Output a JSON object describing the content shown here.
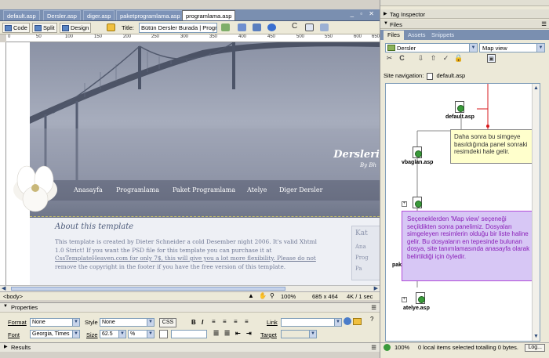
{
  "doc_tabs": [
    "default.asp",
    "Dersler.asp",
    "diger.asp",
    "paketprogramlama.asp",
    "programlama.asp"
  ],
  "active_tab_index": 4,
  "toolbar": {
    "code_label": "Code",
    "split_label": "Split",
    "design_label": "Design",
    "title_label": "Title:",
    "title_value": "Bütün Dersler Burada | Progra"
  },
  "page": {
    "brand": "Dersleri",
    "brand_sub": "By Bh",
    "nav_items": [
      "Anasayfa",
      "Programlama",
      "Paket Programlama",
      "Atelye",
      "Diger Dersler"
    ],
    "about_title": "About this template",
    "about_lines": [
      "This template is created by Dieter Schneider a cold Desember night 2006. It's valid Xhtml",
      "1.0 Strict! If you want the PSD file for this template you can purchase it at",
      "CssTemplateHeaven.com for only 7$, this will give you a lot more flexibility. Please do not",
      "remove the copyright in the footer if you have the free version of this template."
    ],
    "about_link": "CssTemplateHeaven.com",
    "side_card": [
      "Kat",
      "Ana",
      "Prog",
      "Pa"
    ]
  },
  "ruler_marks": [
    "0",
    "50",
    "100",
    "150",
    "200",
    "250",
    "300",
    "350",
    "400",
    "450",
    "500",
    "550",
    "600",
    "650"
  ],
  "status": {
    "tag": "<body>",
    "zoom": "100%",
    "size": "685 x 464",
    "download": "4K / 1 sec"
  },
  "properties": {
    "title": "Properties",
    "format_label": "Format",
    "format_value": "None",
    "style_label": "Style",
    "style_value": "None",
    "css_label": "CSS",
    "link_label": "Link",
    "font_label": "Font",
    "font_value": "Georgia, Times",
    "size_label": "Size",
    "size_value": "62.5",
    "size_unit": "%",
    "target_label": "Target"
  },
  "results_label": "Results",
  "panel": {
    "tag_inspector": "Tag Inspector",
    "files": "Files",
    "tabs": [
      "Files",
      "Assets",
      "Snippets"
    ],
    "site_select": "Dersler",
    "view_select": "Map view",
    "site_nav_label": "Site navigation:",
    "site_nav_file": "default.asp",
    "nodes": [
      "default.asp",
      "vbaglan.asp",
      "p",
      "pak",
      "atelye.asp"
    ],
    "callout1": "Daha sonra bu simgeye basıldığında panel sonraki resimdeki hale gelir.",
    "callout2": "Seçeneklerden 'Map view' seçeneği seçildikten sonra panelimiz. Dosyaları simgeleyen resimlerin olduğu bir liste haline gelir. Bu dosyaların en tepesinde bulunan dosya, site tanımlamasında anasayfa olarak belirtildiği için öyledir.",
    "status_zoom": "100%",
    "status_text": "0 local items selected totalling 0 bytes.",
    "log_button": "Log..."
  },
  "colors": {
    "accent": "#d7191c",
    "callout_purple": "#d7c7f5",
    "callout_yellow": "#ffffcc"
  }
}
